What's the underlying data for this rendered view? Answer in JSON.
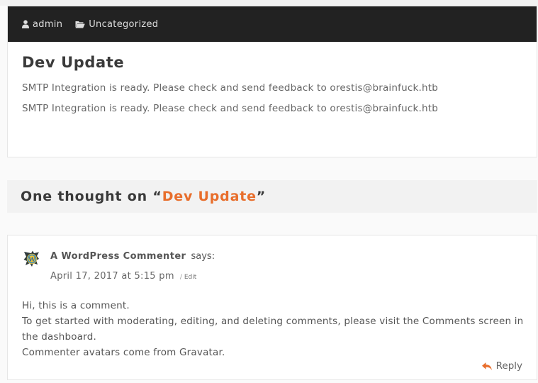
{
  "post": {
    "author": "admin",
    "category": "Uncategorized",
    "title": "Dev Update",
    "paragraphs": [
      "SMTP Integration is ready. Please check and send feedback to orestis@brainfuck.htb",
      "SMTP Integration is ready. Please check and send feedback to orestis@brainfuck.htb"
    ]
  },
  "comments_section": {
    "heading_prefix": "One thought on “",
    "heading_link": "Dev Update",
    "heading_suffix": "”"
  },
  "comment": {
    "author": "A WordPress Commenter",
    "says": "says:",
    "date": "April 17, 2017 at 5:15 pm",
    "separator": "/",
    "edit_label": "Edit",
    "body_lines": [
      "Hi, this is a comment.",
      "To get started with moderating, editing, and deleting comments, please visit the Comments screen in the dashboard.",
      "Commenter avatars come from Gravatar."
    ],
    "reply_label": "Reply"
  },
  "icons": {
    "author": "user-icon",
    "category": "folder-open-icon",
    "avatar": "wordpress-avatar",
    "reply": "reply-icon"
  },
  "colors": {
    "meta_bar": "#222222",
    "accent": "#e86e2c",
    "band": "#f2f2f2"
  }
}
